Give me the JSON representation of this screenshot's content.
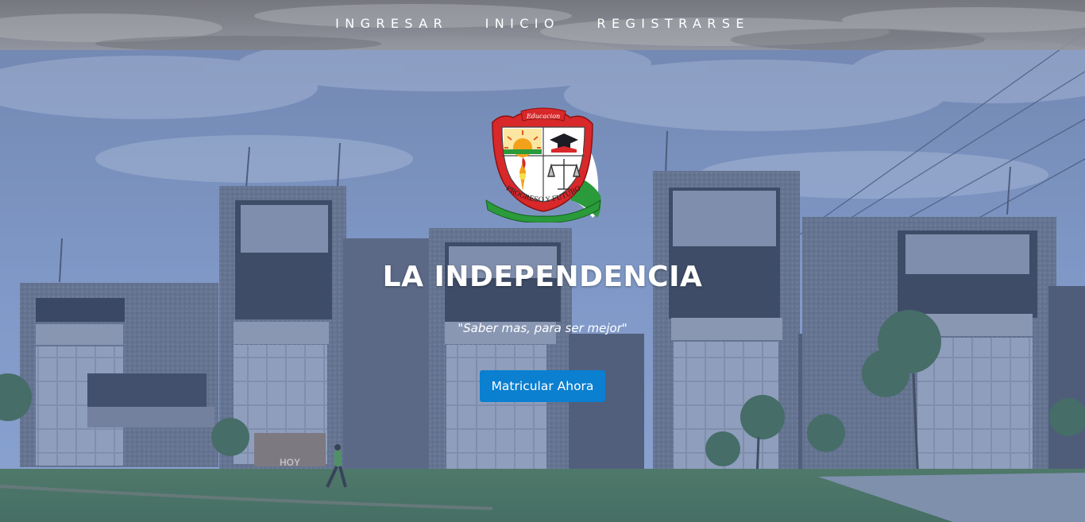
{
  "nav": {
    "items": [
      {
        "label": "INGRESAR"
      },
      {
        "label": "INICIO"
      },
      {
        "label": "REGISTRARSE"
      }
    ]
  },
  "hero": {
    "crest": {
      "banner_text": "Educacion",
      "ribbon_text": "PROGRESO Y FUTURO",
      "icons": [
        "sun-icon",
        "graduation-cap-icon",
        "torch-icon",
        "scales-icon",
        "flag-icon"
      ]
    },
    "title": "LA INDEPENDENCIA",
    "slogan": "\"Saber mas, para ser mejor\"",
    "cta_label": "Matricular Ahora"
  },
  "background": {
    "sign_text": "HOY"
  },
  "colors": {
    "overlay": "#5a78b4",
    "cta": "#0b7fd0",
    "nav_text": "#ffffff",
    "crest_red": "#d8282a",
    "crest_green": "#2a9a3a"
  }
}
